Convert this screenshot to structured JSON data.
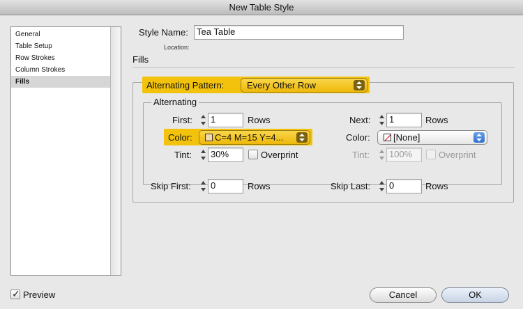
{
  "window": {
    "title": "New Table Style"
  },
  "sidebar": {
    "items": [
      {
        "label": "General"
      },
      {
        "label": "Table Setup"
      },
      {
        "label": "Row Strokes"
      },
      {
        "label": "Column Strokes"
      },
      {
        "label": "Fills"
      }
    ],
    "selected": "Fills"
  },
  "style_name": {
    "label": "Style Name:",
    "value": "Tea Table",
    "location_label": "Location:"
  },
  "section": {
    "title": "Fills"
  },
  "alternating_pattern": {
    "label": "Alternating Pattern:",
    "value": "Every Other Row"
  },
  "alternating": {
    "title": "Alternating",
    "first": {
      "label": "First:",
      "value": "1",
      "unit": "Rows"
    },
    "next": {
      "label": "Next:",
      "value": "1",
      "unit": "Rows"
    },
    "color1": {
      "label": "Color:",
      "value": "C=4 M=15 Y=4..."
    },
    "color2": {
      "label": "Color:",
      "value": "[None]"
    },
    "tint1": {
      "label": "Tint:",
      "value": "30%",
      "overprint_label": "Overprint"
    },
    "tint2": {
      "label": "Tint:",
      "value": "100%",
      "overprint_label": "Overprint"
    }
  },
  "skip": {
    "first": {
      "label": "Skip First:",
      "value": "0",
      "unit": "Rows"
    },
    "last": {
      "label": "Skip Last:",
      "value": "0",
      "unit": "Rows"
    }
  },
  "footer": {
    "preview_label": "Preview",
    "preview_checked": true,
    "cancel_label": "Cancel",
    "ok_label": "OK"
  },
  "colors": {
    "highlight": "#f3c20c",
    "swatch_tea": "#f3d7ad",
    "none_slash": "#e00000"
  },
  "icons": [
    "stepper-icon",
    "popup-arrows-icon",
    "none-swatch-icon",
    "checkmark-icon"
  ]
}
